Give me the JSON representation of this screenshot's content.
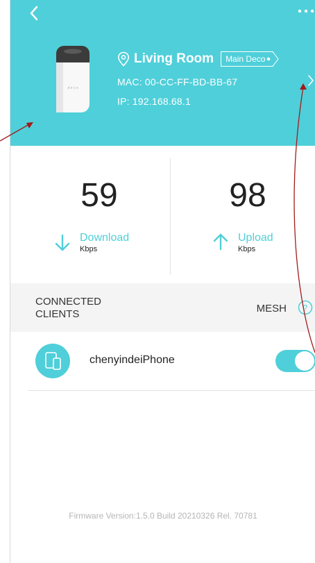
{
  "device": {
    "location": "Living Room",
    "badge": "Main Deco",
    "mac": "MAC: 00-CC-FF-BD-BB-67",
    "ip": "IP: 192.168.68.1"
  },
  "stats": {
    "download": {
      "value": "59",
      "label": "Download",
      "unit": "Kbps"
    },
    "upload": {
      "value": "98",
      "label": "Upload",
      "unit": "Kbps"
    }
  },
  "clients": {
    "title": "CONNECTED CLIENTS",
    "mesh_label": "MESH",
    "items": [
      {
        "name": "chenyindeiPhone",
        "enabled": true
      }
    ]
  },
  "firmware": "Firmware Version:1.5.0 Build 20210326 Rel. 70781",
  "colors": {
    "accent": "#4fcfd9",
    "annotation": "#a11a1a"
  },
  "icons": [
    "back-arrow-icon",
    "more-dots-icon",
    "location-pin-icon",
    "chevron-right-icon",
    "download-arrow-icon",
    "upload-arrow-icon",
    "help-icon",
    "phone-device-icon"
  ]
}
